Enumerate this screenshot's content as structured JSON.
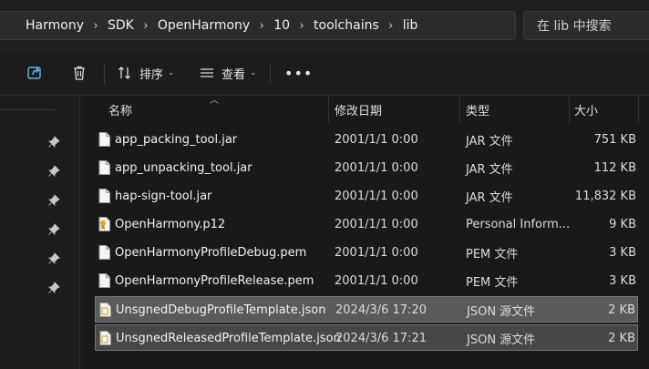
{
  "breadcrumb": [
    "Harmony",
    "SDK",
    "OpenHarmony",
    "10",
    "toolchains",
    "lib"
  ],
  "search": {
    "placeholder": "在 lib 中搜索"
  },
  "toolbar": {
    "sort_label": "排序",
    "view_label": "查看"
  },
  "columns": {
    "name": "名称",
    "date": "修改日期",
    "type": "类型",
    "size": "大小"
  },
  "files": [
    {
      "name": "app_packing_tool.jar",
      "date": "2001/1/1 0:00",
      "type": "JAR 文件",
      "size": "751 KB",
      "icon": "file-icon"
    },
    {
      "name": "app_unpacking_tool.jar",
      "date": "2001/1/1 0:00",
      "type": "JAR 文件",
      "size": "112 KB",
      "icon": "file-icon"
    },
    {
      "name": "hap-sign-tool.jar",
      "date": "2001/1/1 0:00",
      "type": "JAR 文件",
      "size": "11,832 KB",
      "icon": "file-icon"
    },
    {
      "name": "OpenHarmony.p12",
      "date": "2001/1/1 0:00",
      "type": "Personal Inform...",
      "size": "9 KB",
      "icon": "certificate-file-icon"
    },
    {
      "name": "OpenHarmonyProfileDebug.pem",
      "date": "2001/1/1 0:00",
      "type": "PEM 文件",
      "size": "3 KB",
      "icon": "file-icon"
    },
    {
      "name": "OpenHarmonyProfileRelease.pem",
      "date": "2001/1/1 0:00",
      "type": "PEM 文件",
      "size": "3 KB",
      "icon": "file-icon"
    },
    {
      "name": "UnsgnedDebugProfileTemplate.json",
      "date": "2024/3/6 17:20",
      "type": "JSON 源文件",
      "size": "2 KB",
      "icon": "json-file-icon",
      "selected": true
    },
    {
      "name": "UnsgnedReleasedProfileTemplate.json",
      "date": "2024/3/6 17:21",
      "type": "JSON 源文件",
      "size": "2 KB",
      "icon": "json-file-icon",
      "selected": true
    }
  ],
  "colors": {
    "background": "#191919",
    "selection": "#5a5a5a",
    "accent": "#4cc2ff"
  }
}
